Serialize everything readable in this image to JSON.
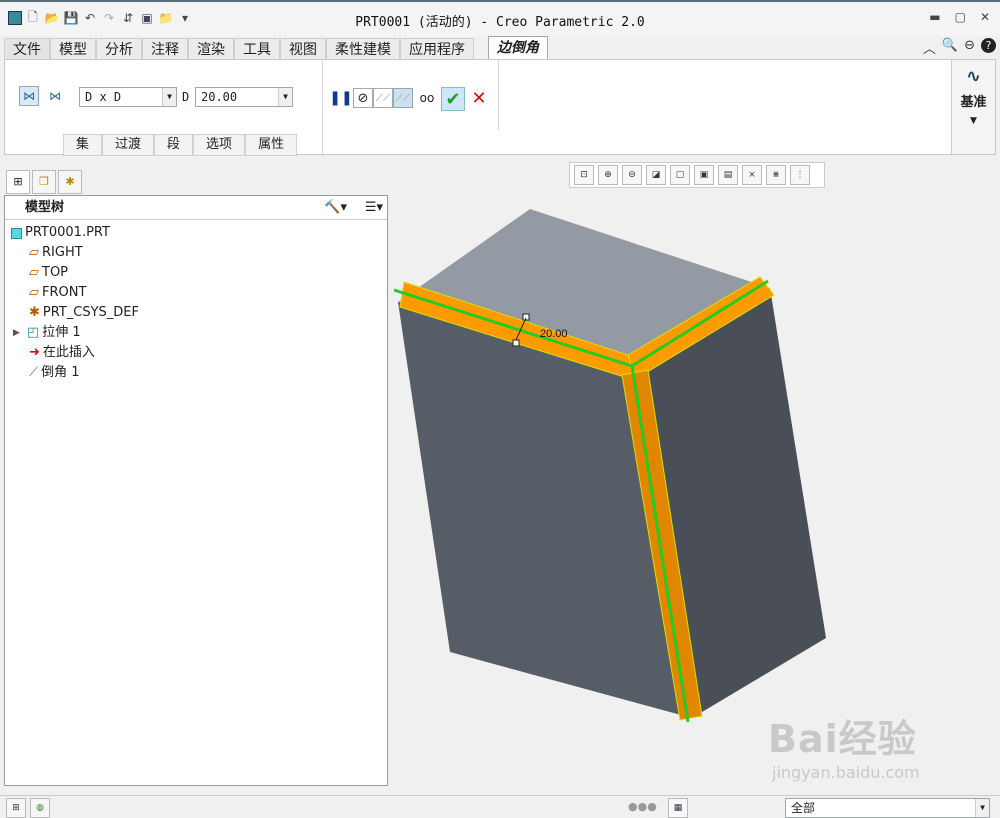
{
  "window": {
    "title": "PRT0001 (活动的) - Creo Parametric 2.0"
  },
  "tabs": [
    "文件",
    "模型",
    "分析",
    "注释",
    "渲染",
    "工具",
    "视图",
    "柔性建模",
    "应用程序"
  ],
  "active_tab": "边倒角",
  "ribbon": {
    "scheme_value": "D x D",
    "dim_label": "D",
    "dim_value": "20.00",
    "panels": [
      "集",
      "过渡",
      "段",
      "选项",
      "属性"
    ],
    "base_label": "基准"
  },
  "model_tree": {
    "header": "模型树",
    "items": [
      "PRT0001.PRT",
      "RIGHT",
      "TOP",
      "FRONT",
      "PRT_CSYS_DEF",
      "拉伸 1",
      "在此插入",
      "倒角 1"
    ]
  },
  "viewport": {
    "dimension_label": "20.00"
  },
  "status": {
    "filter_value": "全部"
  },
  "watermark": {
    "brand": "Bai经验",
    "url": "jingyan.baidu.com"
  },
  "colors": {
    "accent": "#ff9a00",
    "edge": "#22cc22",
    "model": "#5a5f66"
  }
}
